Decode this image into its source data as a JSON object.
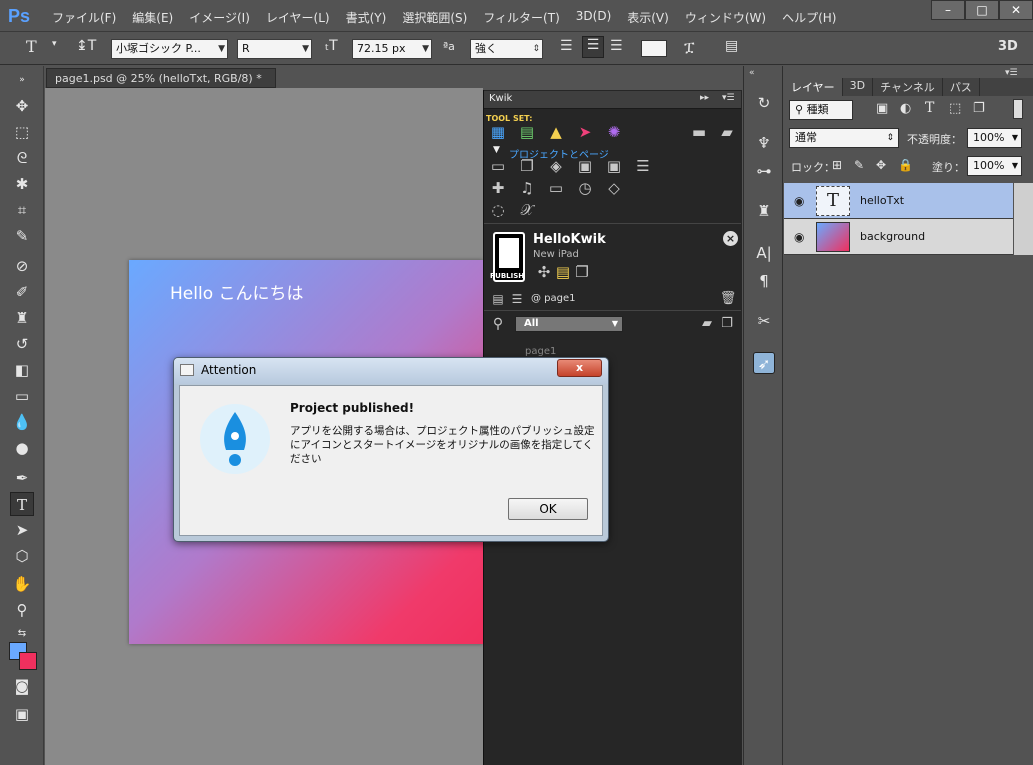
{
  "app": {
    "logo": "Ps"
  },
  "menu": [
    "ファイル(F)",
    "編集(E)",
    "イメージ(I)",
    "レイヤー(L)",
    "書式(Y)",
    "選択範囲(S)",
    "フィルター(T)",
    "3D(D)",
    "表示(V)",
    "ウィンドウ(W)",
    "ヘルプ(H)"
  ],
  "window_controls": {
    "minimize": "–",
    "maximize": "□",
    "close": "✕"
  },
  "options": {
    "tool_glyph": "T",
    "font_family": "小塚ゴシック P...",
    "font_style": "R",
    "font_size": "72.15 px",
    "aa_label": "ªa",
    "antialias": "強く",
    "mode_3d": "3D"
  },
  "document": {
    "tab_title": "page1.psd @ 25% (helloTxt, RGB/8) *",
    "tab_close": "×",
    "canvas_text": "Hello こんにちは"
  },
  "kwik": {
    "panel_title": "Kwik",
    "toolset_label": "TOOL SET:",
    "project_section_label": "プロジェクトとページ",
    "project_name": "HelloKwik",
    "project_device": "New iPad",
    "publish_label": "PUBLISH",
    "page_ref": "@ page1",
    "filter_value": "All",
    "page_list": [
      "page1"
    ]
  },
  "layers": {
    "tabs": [
      "レイヤー",
      "3D",
      "チャンネル",
      "パス"
    ],
    "kind_label": "種類",
    "blend_mode": "通常",
    "opacity_label": "不透明度：",
    "opacity_value": "100%",
    "lock_label": "ロック：",
    "fill_label": "塗り：",
    "fill_value": "100%",
    "items": [
      {
        "name": "helloTxt",
        "type": "text",
        "selected": true
      },
      {
        "name": "background",
        "type": "image",
        "selected": false
      }
    ]
  },
  "dialog": {
    "title": "Attention",
    "heading": "Project published!",
    "message": "アプリを公開する場合は、プロジェクト属性のパブリッシュ設定にアイコンとスタートイメージをオリジナルの画像を指定してください",
    "ok_label": "OK",
    "close_glyph": "x"
  },
  "colors": {
    "foreground": "#6aa9ff",
    "background": "#f0305e",
    "selected_layer": "#a9c1ea",
    "kwik_accent": "#4aa7ff"
  }
}
